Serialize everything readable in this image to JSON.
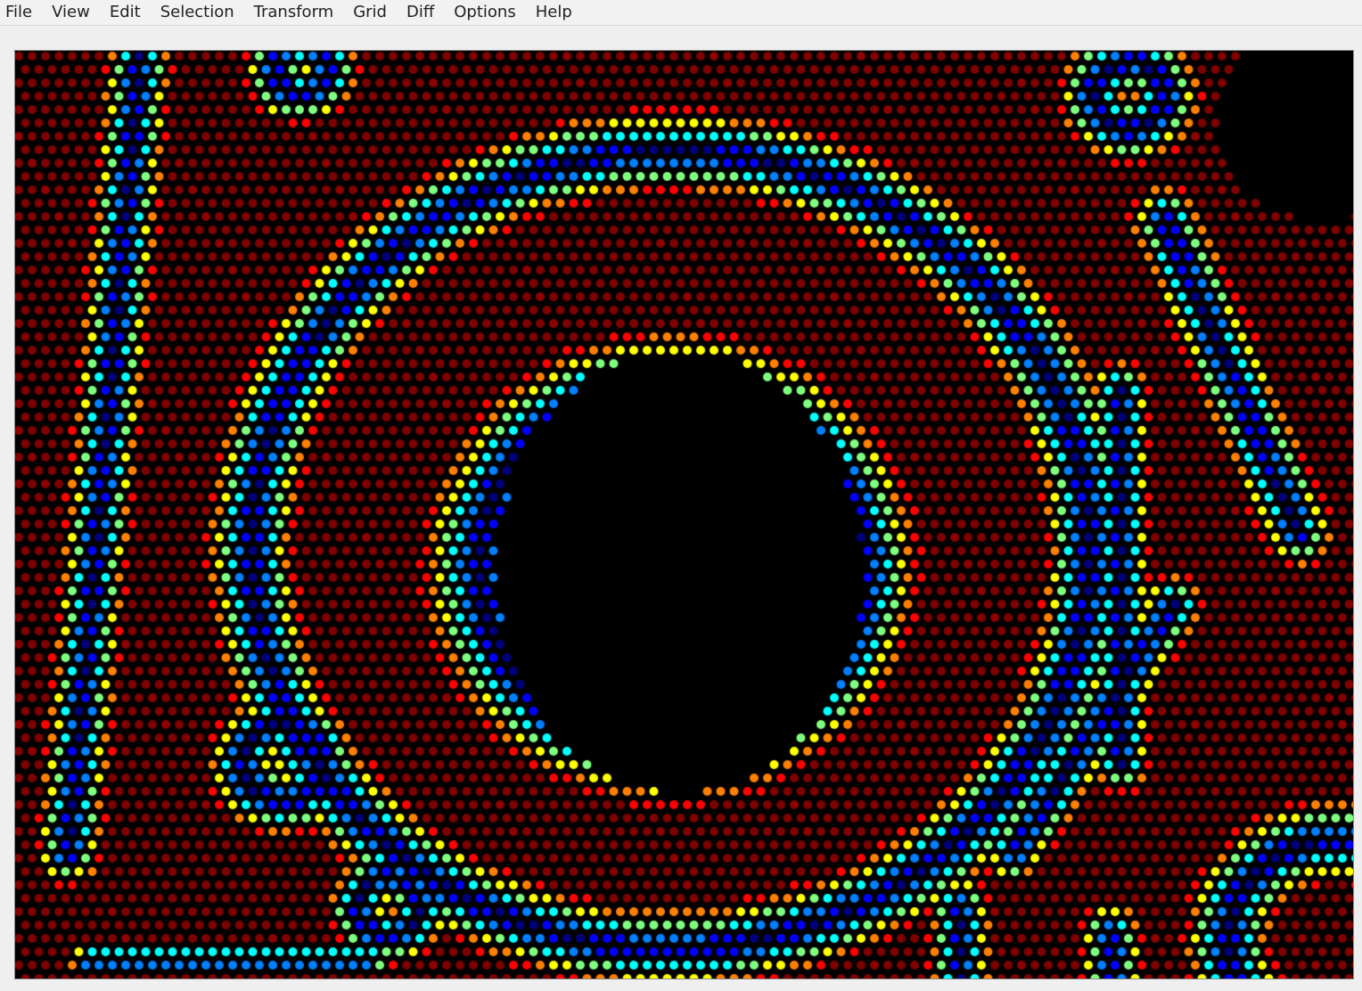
{
  "menu": {
    "items": [
      "File",
      "View",
      "Edit",
      "Selection",
      "Transform",
      "Grid",
      "Diff",
      "Options",
      "Help"
    ]
  },
  "canvas": {
    "background": "#000000",
    "colormap": [
      "#00007f",
      "#0000ff",
      "#007fff",
      "#00ffff",
      "#7fff7f",
      "#ffff00",
      "#ff7f00",
      "#ff0000",
      "#7f0000"
    ]
  }
}
